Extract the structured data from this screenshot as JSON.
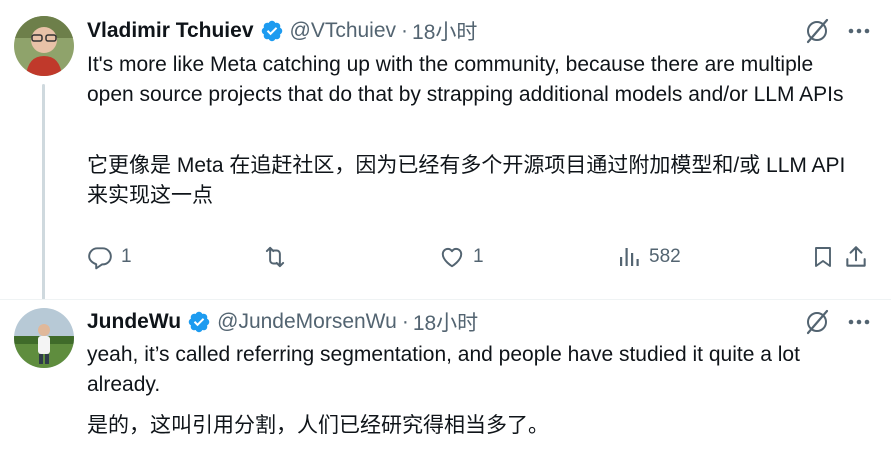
{
  "tweets": [
    {
      "author": {
        "name": "Vladimir Tchuiev",
        "handle": "@VTchuiev",
        "separator": "·",
        "time": "18小时",
        "verified": true,
        "avatar_icon": "avatar-photo"
      },
      "text_en": "It's more like Meta catching up with the community, because there are multiple open source projects that do that by strapping additional models and/or LLM APIs",
      "text_translation": "它更像是 Meta 在追赶社区，因为已经有多个开源项目通过附加模型和/或 LLM API 来实现这一点",
      "stats": {
        "replies": "1",
        "retweets": "",
        "likes": "1",
        "views": "582"
      }
    },
    {
      "author": {
        "name": "JundeWu",
        "handle": "@JundeMorsenWu",
        "separator": "·",
        "time": "18小时",
        "verified": true,
        "avatar_icon": "avatar-photo"
      },
      "text_en": "yeah, it’s called referring segmentation, and people have studied it quite a lot already.",
      "text_translation": "是的，这叫引用分割，人们已经研究得相当多了。"
    }
  ],
  "icons": {
    "verified": "verified-badge-icon",
    "translate": "translate-icon",
    "more": "more-icon",
    "reply": "reply-icon",
    "retweet": "retweet-icon",
    "like": "like-icon",
    "views": "views-icon",
    "bookmark": "bookmark-icon",
    "share": "share-icon"
  },
  "colors": {
    "verified": "#1d9bf0",
    "text": "#0f1419",
    "muted": "#536471",
    "thread_line": "#cfd9de"
  }
}
